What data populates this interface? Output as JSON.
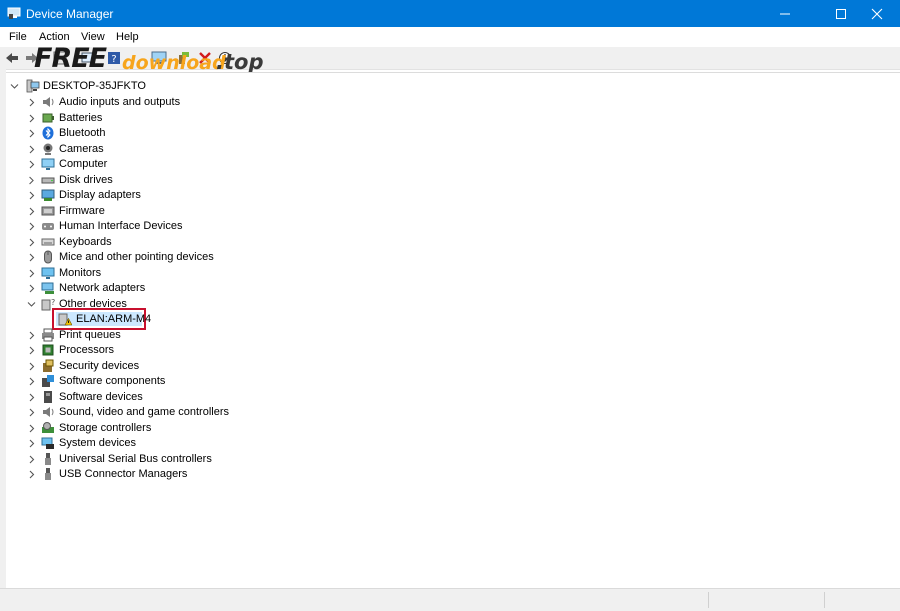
{
  "window": {
    "title": "Device Manager",
    "controls": [
      "minimize",
      "maximize",
      "close"
    ]
  },
  "menu": {
    "items": [
      "File",
      "Action",
      "View",
      "Help"
    ]
  },
  "toolbar": {
    "icons": [
      "back-arrow-icon",
      "forward-arrow-icon",
      "properties-icon",
      "update-driver-icon",
      "help-icon",
      "computer-icon",
      "scan-hardware-icon",
      "uninstall-icon",
      "download-icon"
    ]
  },
  "watermark": {
    "free": "FREE",
    "download": "download",
    "top": ".top"
  },
  "tree": {
    "root": "DESKTOP-35JFKTO",
    "categories": [
      {
        "label": "Audio inputs and outputs",
        "icon": "speaker-icon"
      },
      {
        "label": "Batteries",
        "icon": "battery-icon"
      },
      {
        "label": "Bluetooth",
        "icon": "bluetooth-icon"
      },
      {
        "label": "Cameras",
        "icon": "camera-icon"
      },
      {
        "label": "Computer",
        "icon": "computer-icon"
      },
      {
        "label": "Disk drives",
        "icon": "disk-drive-icon"
      },
      {
        "label": "Display adapters",
        "icon": "display-adapter-icon"
      },
      {
        "label": "Firmware",
        "icon": "firmware-icon"
      },
      {
        "label": "Human Interface Devices",
        "icon": "hid-icon"
      },
      {
        "label": "Keyboards",
        "icon": "keyboard-icon"
      },
      {
        "label": "Mice and other pointing devices",
        "icon": "mouse-icon"
      },
      {
        "label": "Monitors",
        "icon": "monitor-icon"
      },
      {
        "label": "Network adapters",
        "icon": "network-adapter-icon"
      },
      {
        "label": "Other devices",
        "icon": "unknown-device-icon",
        "expanded": true,
        "children": [
          {
            "label": "ELAN:ARM-M4",
            "icon": "warning-device-icon",
            "selected": true
          }
        ]
      },
      {
        "label": "Print queues",
        "icon": "printer-icon"
      },
      {
        "label": "Processors",
        "icon": "processor-icon"
      },
      {
        "label": "Security devices",
        "icon": "security-device-icon"
      },
      {
        "label": "Software components",
        "icon": "software-component-icon"
      },
      {
        "label": "Software devices",
        "icon": "software-device-icon"
      },
      {
        "label": "Sound, video and game controllers",
        "icon": "sound-controller-icon"
      },
      {
        "label": "Storage controllers",
        "icon": "storage-controller-icon"
      },
      {
        "label": "System devices",
        "icon": "system-devices-icon"
      },
      {
        "label": "Universal Serial Bus controllers",
        "icon": "usb-icon"
      },
      {
        "label": "USB Connector Managers",
        "icon": "usb-connector-icon"
      }
    ]
  },
  "colors": {
    "titlebar": "#0078d7",
    "selection": "#cce8ff",
    "highlight_border": "#c8102e",
    "warning": "#f2c200"
  }
}
